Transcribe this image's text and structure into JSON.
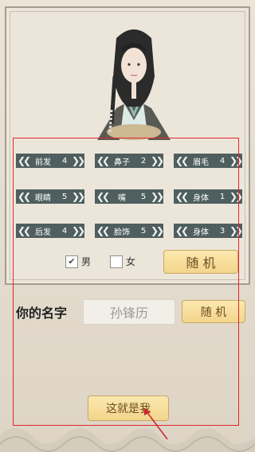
{
  "panel": {
    "features": [
      {
        "label": "前发",
        "value": "4"
      },
      {
        "label": "鼻子",
        "value": "2"
      },
      {
        "label": "眉毛",
        "value": "4"
      },
      {
        "label": "眼睛",
        "value": "5"
      },
      {
        "label": "嘴",
        "value": "5"
      },
      {
        "label": "身体",
        "value": "1"
      },
      {
        "label": "后发",
        "value": "4"
      },
      {
        "label": "脸饰",
        "value": "5"
      },
      {
        "label": "身体",
        "value": "3"
      }
    ],
    "gender": {
      "male": "男",
      "female": "女",
      "male_checked": true,
      "female_checked": false
    },
    "random_label": "随 机"
  },
  "name_section": {
    "label": "你的名字",
    "name_value": "孙锋历",
    "random_label": "随 机"
  },
  "confirm_label": "这就是我",
  "colors": {
    "selector": "#4f5f5f",
    "gold": "#f3d58c",
    "highlight": "#e0252b"
  }
}
